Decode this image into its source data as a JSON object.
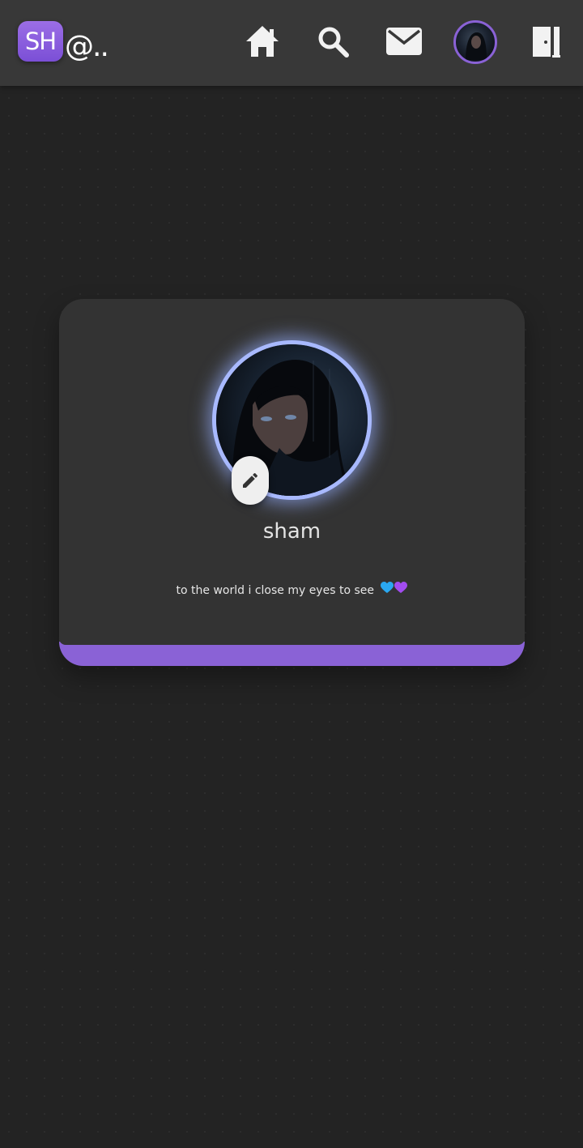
{
  "header": {
    "logo_text": "SH",
    "handle_text": "@..",
    "nav": [
      {
        "name": "home",
        "icon": "home-icon"
      },
      {
        "name": "search",
        "icon": "search-icon"
      },
      {
        "name": "messages",
        "icon": "mail-icon"
      },
      {
        "name": "profile",
        "icon": "avatar"
      },
      {
        "name": "logout",
        "icon": "door-exit-icon"
      }
    ]
  },
  "profile": {
    "username": "sham",
    "bio": "to the world i close my eyes to see",
    "bio_emoji": [
      "blue-heart-icon",
      "purple-heart-icon"
    ],
    "edit_icon": "pencil-icon"
  },
  "colors": {
    "accent": "#8a62d6",
    "avatar_glow": "#a8b9ff",
    "background": "#232323",
    "topbar": "#383838",
    "card": "#333333",
    "blue_heart": "#2aa8f0",
    "purple_heart": "#a24cf0"
  }
}
